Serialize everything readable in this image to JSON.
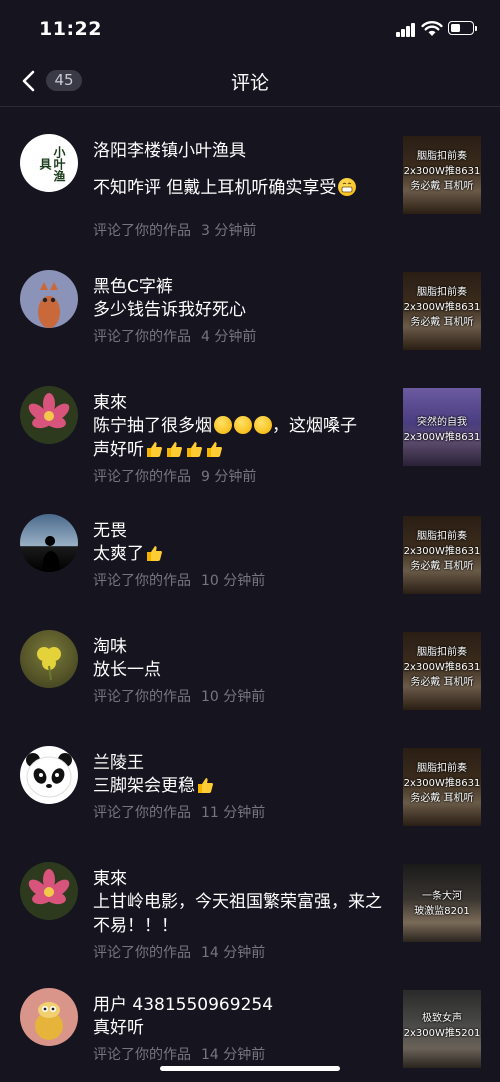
{
  "status": {
    "time": "11:22"
  },
  "nav": {
    "badge": "45",
    "title": "评论"
  },
  "items": [
    {
      "name": "洛阳李楼镇小叶渔具",
      "comment": "不知咋评 但戴上耳机听确实享受",
      "action": "评论了你的作品",
      "ago": "3 分钟前",
      "thumb": [
        "胭脂扣前奏",
        "2x300W推8631",
        "务必戴  耳机听"
      ],
      "avatar_text": "小叶渔具",
      "emoji": "grin"
    },
    {
      "name": "黑色C字裤",
      "comment": "多少钱告诉我好死心",
      "action": "评论了你的作品",
      "ago": "4 分钟前",
      "thumb": [
        "胭脂扣前奏",
        "2x300W推8631",
        "务必戴  耳机听"
      ]
    },
    {
      "name": "東來",
      "comment": "陈宁抽了很多烟",
      "comment2": "，这烟嗓子",
      "comment3": "声好听",
      "action": "评论了你的作品",
      "ago": "9 分钟前",
      "thumb": [
        "突然的自我",
        "2x300W推8631"
      ]
    },
    {
      "name": "无畏",
      "comment": "太爽了",
      "action": "评论了你的作品",
      "ago": "10 分钟前",
      "thumb": [
        "胭脂扣前奏",
        "2x300W推8631",
        "务必戴  耳机听"
      ]
    },
    {
      "name": "淘味",
      "comment": "放长一点",
      "action": "评论了你的作品",
      "ago": "10 分钟前",
      "thumb": [
        "胭脂扣前奏",
        "2x300W推8631",
        "务必戴  耳机听"
      ]
    },
    {
      "name": "兰陵王",
      "comment": "三脚架会更稳",
      "action": "评论了你的作品",
      "ago": "11 分钟前",
      "thumb": [
        "胭脂扣前奏",
        "2x300W推8631",
        "务必戴  耳机听"
      ]
    },
    {
      "name": "東來",
      "comment": "上甘岭电影，今天祖国繁荣富强，来之不易！！！",
      "action": "评论了你的作品",
      "ago": "14 分钟前",
      "thumb": [
        "一条大河",
        "玻激监8201"
      ]
    },
    {
      "name": "用户 4381550969254",
      "comment": "真好听",
      "action": "评论了你的作品",
      "ago": "14 分钟前",
      "thumb": [
        "极致女声",
        "2x300W推5201"
      ]
    }
  ]
}
